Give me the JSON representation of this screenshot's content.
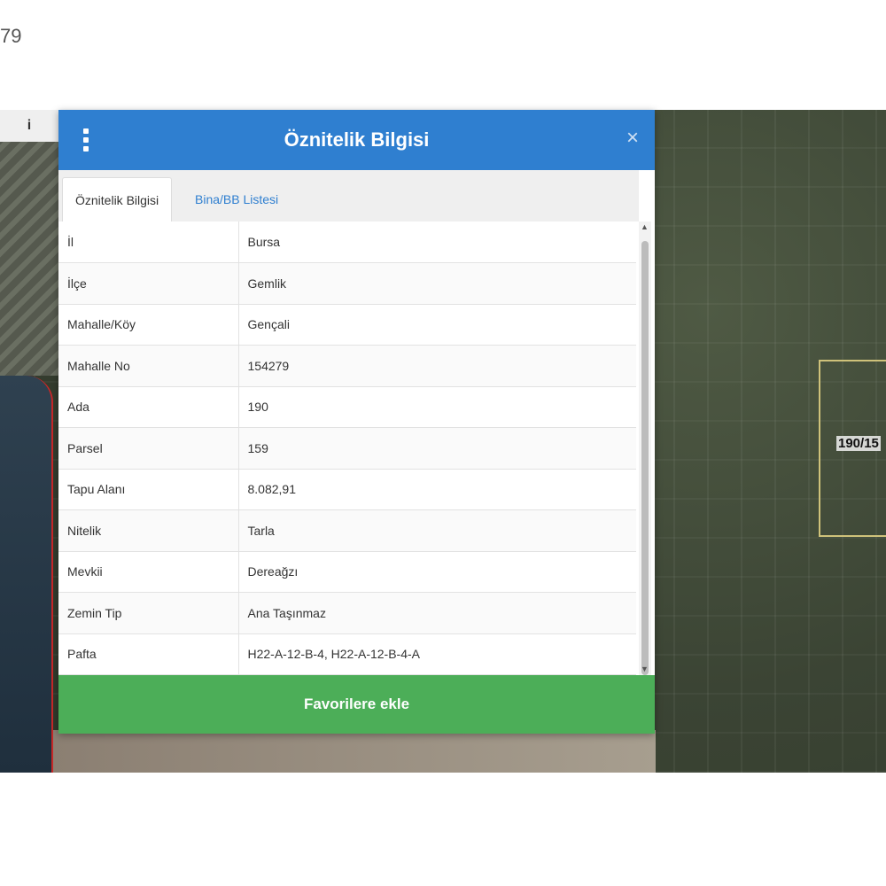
{
  "corner_text": "79",
  "map": {
    "info_button": "i",
    "parcel_label": "190/15"
  },
  "dialog": {
    "title": "Öznitelik Bilgisi",
    "close": "×",
    "tabs": [
      {
        "label": "Öznitelik Bilgisi",
        "active": true
      },
      {
        "label": "Bina/BB Listesi",
        "active": false
      }
    ],
    "rows": [
      {
        "key": "İl",
        "value": "Bursa"
      },
      {
        "key": "İlçe",
        "value": "Gemlik"
      },
      {
        "key": "Mahalle/Köy",
        "value": "Gençali"
      },
      {
        "key": "Mahalle No",
        "value": "154279"
      },
      {
        "key": "Ada",
        "value": "190"
      },
      {
        "key": "Parsel",
        "value": "159"
      },
      {
        "key": "Tapu Alanı",
        "value": "8.082,91"
      },
      {
        "key": "Nitelik",
        "value": "Tarla"
      },
      {
        "key": "Mevkii",
        "value": "Dereağzı"
      },
      {
        "key": "Zemin Tip",
        "value": "Ana Taşınmaz"
      },
      {
        "key": "Pafta",
        "value": "H22-A-12-B-4, H22-A-12-B-4-A"
      }
    ],
    "favorite_button": "Favorilere ekle"
  },
  "colors": {
    "header": "#2f7fd0",
    "button": "#4cae58"
  }
}
